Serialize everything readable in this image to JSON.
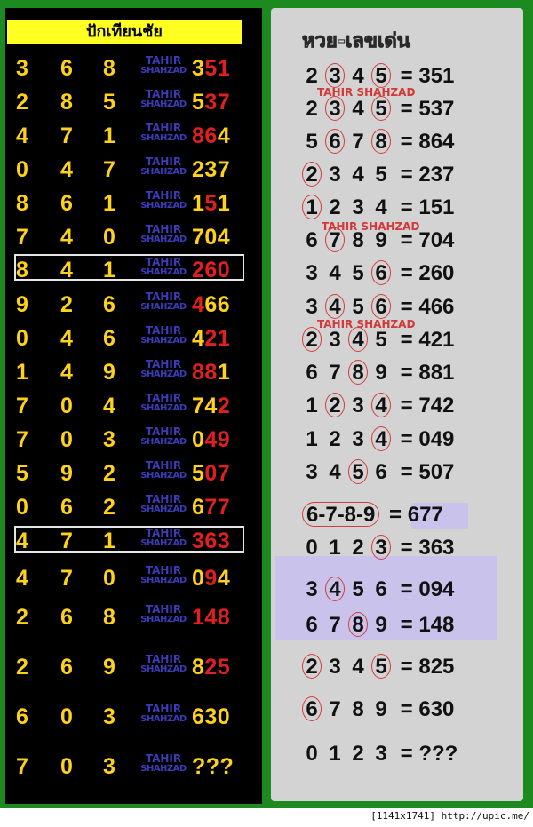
{
  "left_title": "ปักเทียนชัย",
  "right_title": "หวย-เลขเด่น",
  "tahir": {
    "line1": "TAHIR",
    "line2": "SHAHZAD"
  },
  "watermark": "TAHIR SHAHZAD",
  "footer": "[1141x1741] http://upic.me/",
  "colors": {
    "yellow": "#ffd21a",
    "red": "#e02020",
    "blue": "#3c3cb8",
    "green": "#1d8a1f"
  },
  "left_rows": [
    {
      "digits": [
        "3",
        "6",
        "8"
      ],
      "result": [
        {
          "t": "3",
          "c": "yellow"
        },
        {
          "t": "51",
          "c": "red"
        }
      ]
    },
    {
      "digits": [
        "2",
        "8",
        "5"
      ],
      "result": [
        {
          "t": "5",
          "c": "yellow"
        },
        {
          "t": "37",
          "c": "red"
        }
      ]
    },
    {
      "digits": [
        "4",
        "7",
        "1"
      ],
      "result": [
        {
          "t": "86",
          "c": "red"
        },
        {
          "t": "4",
          "c": "yellow"
        }
      ]
    },
    {
      "digits": [
        "0",
        "4",
        "7"
      ],
      "result": [
        {
          "t": "237",
          "c": "yellow"
        }
      ]
    },
    {
      "digits": [
        "8",
        "6",
        "1"
      ],
      "result": [
        {
          "t": "1",
          "c": "yellow"
        },
        {
          "t": "5",
          "c": "red"
        },
        {
          "t": "1",
          "c": "yellow"
        }
      ]
    },
    {
      "digits": [
        "7",
        "4",
        "0"
      ],
      "result": [
        {
          "t": "704",
          "c": "yellow"
        }
      ]
    },
    {
      "digits": [
        "8",
        "4",
        "1"
      ],
      "result": [
        {
          "t": "260",
          "c": "red"
        }
      ]
    },
    {
      "digits": [
        "9",
        "2",
        "6"
      ],
      "result": [
        {
          "t": "4",
          "c": "red"
        },
        {
          "t": "66",
          "c": "yellow"
        }
      ]
    },
    {
      "digits": [
        "0",
        "4",
        "6"
      ],
      "result": [
        {
          "t": "4",
          "c": "yellow"
        },
        {
          "t": "21",
          "c": "red"
        }
      ]
    },
    {
      "digits": [
        "1",
        "4",
        "9"
      ],
      "result": [
        {
          "t": "88",
          "c": "red"
        },
        {
          "t": "1",
          "c": "yellow"
        }
      ]
    },
    {
      "digits": [
        "7",
        "0",
        "4"
      ],
      "result": [
        {
          "t": "74",
          "c": "yellow"
        },
        {
          "t": "2",
          "c": "red"
        }
      ]
    },
    {
      "digits": [
        "7",
        "0",
        "3"
      ],
      "result": [
        {
          "t": "0",
          "c": "yellow"
        },
        {
          "t": "49",
          "c": "red"
        }
      ]
    },
    {
      "digits": [
        "5",
        "9",
        "2"
      ],
      "result": [
        {
          "t": "5",
          "c": "yellow"
        },
        {
          "t": "07",
          "c": "red"
        }
      ]
    },
    {
      "digits": [
        "0",
        "6",
        "2"
      ],
      "result": [
        {
          "t": "6",
          "c": "yellow"
        },
        {
          "t": "77",
          "c": "red"
        }
      ]
    },
    {
      "digits": [
        "4",
        "7",
        "1"
      ],
      "result": [
        {
          "t": "363",
          "c": "red"
        }
      ]
    },
    {
      "digits": [
        "4",
        "7",
        "0"
      ],
      "result": [
        {
          "t": "0",
          "c": "yellow"
        },
        {
          "t": "9",
          "c": "red"
        },
        {
          "t": "4",
          "c": "yellow"
        }
      ]
    },
    {
      "digits": [
        "2",
        "6",
        "8"
      ],
      "result": [
        {
          "t": "148",
          "c": "red"
        }
      ]
    },
    {
      "digits": [
        "2",
        "6",
        "9"
      ],
      "result": [
        {
          "t": "8",
          "c": "yellow"
        },
        {
          "t": "25",
          "c": "red"
        }
      ]
    },
    {
      "digits": [
        "6",
        "0",
        "3"
      ],
      "result": [
        {
          "t": "630",
          "c": "yellow"
        }
      ]
    },
    {
      "digits": [
        "7",
        "0",
        "3"
      ],
      "result": [
        {
          "t": "???",
          "c": "yellow"
        }
      ]
    }
  ],
  "right_rows": [
    {
      "nums": [
        {
          "t": "2",
          "c": false
        },
        {
          "t": "3",
          "c": true
        },
        {
          "t": "4",
          "c": false
        },
        {
          "t": "5",
          "c": true
        }
      ],
      "result": "351"
    },
    {
      "nums": [
        {
          "t": "2",
          "c": false
        },
        {
          "t": "3",
          "c": true
        },
        {
          "t": "4",
          "c": false
        },
        {
          "t": "5",
          "c": true
        }
      ],
      "result": "537"
    },
    {
      "nums": [
        {
          "t": "5",
          "c": false
        },
        {
          "t": "6",
          "c": true
        },
        {
          "t": "7",
          "c": false
        },
        {
          "t": "8",
          "c": true
        }
      ],
      "result": "864"
    },
    {
      "nums": [
        {
          "t": "2",
          "c": true
        },
        {
          "t": "3",
          "c": false
        },
        {
          "t": "4",
          "c": false
        },
        {
          "t": "5",
          "c": false
        }
      ],
      "result": "237"
    },
    {
      "nums": [
        {
          "t": "1",
          "c": true
        },
        {
          "t": "2",
          "c": false
        },
        {
          "t": "3",
          "c": false
        },
        {
          "t": "4",
          "c": false
        }
      ],
      "result": "151"
    },
    {
      "nums": [
        {
          "t": "6",
          "c": false
        },
        {
          "t": "7",
          "c": true
        },
        {
          "t": "8",
          "c": false
        },
        {
          "t": "9",
          "c": false
        }
      ],
      "result": "704"
    },
    {
      "nums": [
        {
          "t": "3",
          "c": false
        },
        {
          "t": "4",
          "c": false
        },
        {
          "t": "5",
          "c": false
        },
        {
          "t": "6",
          "c": true
        }
      ],
      "result": "260"
    },
    {
      "nums": [
        {
          "t": "3",
          "c": false
        },
        {
          "t": "4",
          "c": true
        },
        {
          "t": "5",
          "c": false
        },
        {
          "t": "6",
          "c": true
        }
      ],
      "result": "466"
    },
    {
      "nums": [
        {
          "t": "2",
          "c": true
        },
        {
          "t": "3",
          "c": false
        },
        {
          "t": "4",
          "c": true
        },
        {
          "t": "5",
          "c": false
        }
      ],
      "result": "421"
    },
    {
      "nums": [
        {
          "t": "6",
          "c": false
        },
        {
          "t": "7",
          "c": false
        },
        {
          "t": "8",
          "c": true
        },
        {
          "t": "9",
          "c": false
        }
      ],
      "result": "881"
    },
    {
      "nums": [
        {
          "t": "1",
          "c": false
        },
        {
          "t": "2",
          "c": true
        },
        {
          "t": "3",
          "c": false
        },
        {
          "t": "4",
          "c": true
        }
      ],
      "result": "742"
    },
    {
      "nums": [
        {
          "t": "1",
          "c": false
        },
        {
          "t": "2",
          "c": false
        },
        {
          "t": "3",
          "c": false
        },
        {
          "t": "4",
          "c": true
        }
      ],
      "result": "049"
    },
    {
      "nums": [
        {
          "t": "3",
          "c": false
        },
        {
          "t": "4",
          "c": false
        },
        {
          "t": "5",
          "c": true
        },
        {
          "t": "6",
          "c": false
        }
      ],
      "result": "507"
    },
    {
      "nums": [
        {
          "t": "6-7-8-9",
          "c": true
        }
      ],
      "result": "677"
    },
    {
      "nums": [
        {
          "t": "0",
          "c": false
        },
        {
          "t": "1",
          "c": false
        },
        {
          "t": "2",
          "c": false
        },
        {
          "t": "3",
          "c": true
        }
      ],
      "result": "363"
    },
    {
      "nums": [
        {
          "t": "3",
          "c": false
        },
        {
          "t": "4",
          "c": true
        },
        {
          "t": "5",
          "c": false
        },
        {
          "t": "6",
          "c": false
        }
      ],
      "result": "094"
    },
    {
      "nums": [
        {
          "t": "6",
          "c": false
        },
        {
          "t": "7",
          "c": false
        },
        {
          "t": "8",
          "c": true
        },
        {
          "t": "9",
          "c": false
        }
      ],
      "result": "148"
    },
    {
      "nums": [
        {
          "t": "2",
          "c": true
        },
        {
          "t": "3",
          "c": false
        },
        {
          "t": "4",
          "c": false
        },
        {
          "t": "5",
          "c": true
        }
      ],
      "result": "825"
    },
    {
      "nums": [
        {
          "t": "6",
          "c": true
        },
        {
          "t": "7",
          "c": false
        },
        {
          "t": "8",
          "c": false
        },
        {
          "t": "9",
          "c": false
        }
      ],
      "result": "630"
    },
    {
      "nums": [
        {
          "t": "0",
          "c": false
        },
        {
          "t": "1",
          "c": false
        },
        {
          "t": "2",
          "c": false
        },
        {
          "t": "3",
          "c": false
        }
      ],
      "result": "???"
    }
  ]
}
